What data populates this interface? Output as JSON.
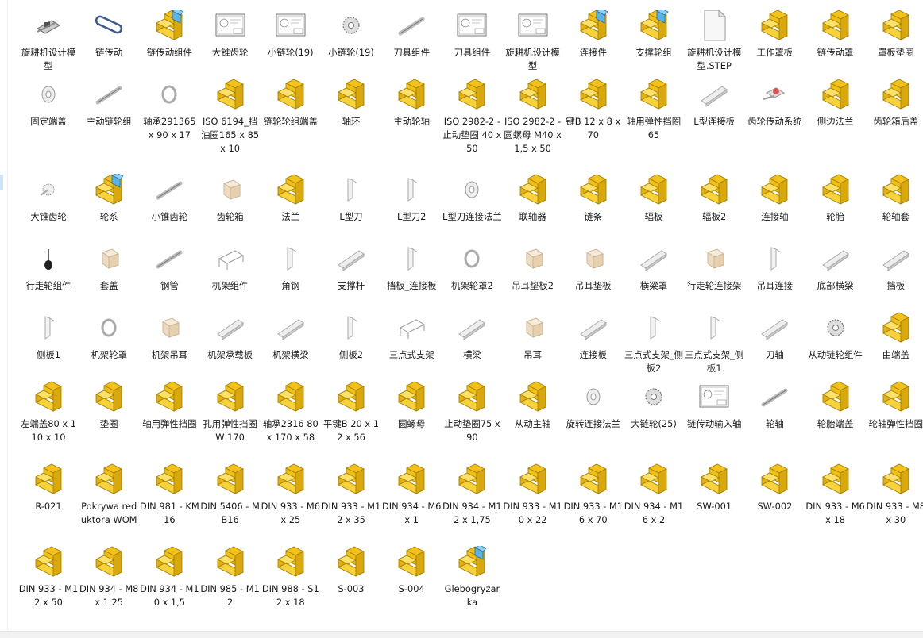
{
  "colors": {
    "part_yellow": "#f2c21b",
    "assembly_blue": "#5ab3e6",
    "line_gray": "#9a9a9a"
  },
  "rows": [
    [
      {
        "label": "旋耕机设计模型",
        "icon": "assembly-thumbnail-icon"
      },
      {
        "label": "链传动",
        "icon": "chain-thumbnail-icon"
      },
      {
        "label": "链传动组件",
        "icon": "assembly-icon"
      },
      {
        "label": "大锥齿轮",
        "icon": "drawing-thumbnail-icon"
      },
      {
        "label": "小链轮(19)",
        "icon": "drawing-thumbnail-icon"
      },
      {
        "label": "小链轮(19)",
        "icon": "sprocket-thumbnail-icon"
      },
      {
        "label": "刀具组件",
        "icon": "shaft-thumbnail-icon"
      },
      {
        "label": "刀具组件",
        "icon": "drawing-thumbnail-icon"
      },
      {
        "label": "旋耕机设计模型",
        "icon": "drawing-thumbnail-icon"
      },
      {
        "label": "连接件",
        "icon": "assembly-icon"
      },
      {
        "label": "支撑轮组",
        "icon": "assembly-icon"
      },
      {
        "label": "旋耕机设计模型.STEP",
        "icon": "file-icon"
      },
      {
        "label": "工作罩板",
        "icon": "part-icon"
      },
      {
        "label": "链传动罩",
        "icon": "part-icon"
      },
      {
        "label": "罩板垫圈",
        "icon": "part-icon"
      }
    ],
    [
      {
        "label": "固定端盖",
        "icon": "disc-thumbnail-icon"
      },
      {
        "label": "主动链轮组",
        "icon": "shaft-thumbnail-icon"
      },
      {
        "label": "轴承291365 x 90 x 17",
        "icon": "ring-thumbnail-icon"
      },
      {
        "label": "ISO 6194_挡油圈165 x 85 x 10",
        "icon": "part-icon"
      },
      {
        "label": "链轮轮组端盖",
        "icon": "part-icon"
      },
      {
        "label": "轴环",
        "icon": "part-icon"
      },
      {
        "label": "主动轮轴",
        "icon": "part-icon"
      },
      {
        "label": "ISO 2982-2 -止动垫圈 40 x 50",
        "icon": "part-icon"
      },
      {
        "label": "ISO 2982-2 -圆螺母 M40 x 1,5 x 50",
        "icon": "part-icon"
      },
      {
        "label": "键B 12 x 8 x 70",
        "icon": "part-icon"
      },
      {
        "label": "轴用弹性挡圈 65",
        "icon": "part-icon"
      },
      {
        "label": "L型连接板",
        "icon": "plate-thumbnail-icon"
      },
      {
        "label": "齿轮传动系统",
        "icon": "gearbox-thumbnail-icon"
      },
      {
        "label": "侧边法兰",
        "icon": "part-icon"
      },
      {
        "label": "齿轮箱后盖",
        "icon": "part-icon"
      }
    ],
    [
      {
        "label": "大锥齿轮",
        "icon": "gear-thumbnail-icon"
      },
      {
        "label": "轮系",
        "icon": "assembly-icon"
      },
      {
        "label": "小锥齿轮",
        "icon": "shaft-thumbnail-icon"
      },
      {
        "label": "齿轮箱",
        "icon": "box-thumbnail-icon"
      },
      {
        "label": "法兰",
        "icon": "part-icon"
      },
      {
        "label": "L型刀",
        "icon": "blade-thumbnail-icon"
      },
      {
        "label": "L型刀2",
        "icon": "blade-thumbnail-icon"
      },
      {
        "label": "L型刀连接法兰",
        "icon": "disc-thumbnail-icon"
      },
      {
        "label": "联轴器",
        "icon": "part-icon"
      },
      {
        "label": "链条",
        "icon": "part-icon"
      },
      {
        "label": "辐板",
        "icon": "part-icon"
      },
      {
        "label": "辐板2",
        "icon": "part-icon"
      },
      {
        "label": "连接轴",
        "icon": "part-icon"
      },
      {
        "label": "轮胎",
        "icon": "part-icon"
      },
      {
        "label": "轮轴套",
        "icon": "part-icon"
      }
    ],
    [
      {
        "label": "行走轮组件",
        "icon": "wheel-thumbnail-icon"
      },
      {
        "label": "套盖",
        "icon": "box-thumbnail-icon"
      },
      {
        "label": "钢管",
        "icon": "shaft-thumbnail-icon"
      },
      {
        "label": "机架组件",
        "icon": "frame-thumbnail-icon"
      },
      {
        "label": "角钢",
        "icon": "blade-thumbnail-icon"
      },
      {
        "label": "支撑杆",
        "icon": "plate-thumbnail-icon"
      },
      {
        "label": "挡板_连接板",
        "icon": "blade-thumbnail-icon"
      },
      {
        "label": "机架轮罩2",
        "icon": "ring-thumbnail-icon"
      },
      {
        "label": "吊耳垫板2",
        "icon": "box-thumbnail-icon"
      },
      {
        "label": "吊耳垫板",
        "icon": "box-thumbnail-icon"
      },
      {
        "label": "横梁罩",
        "icon": "plate-thumbnail-icon"
      },
      {
        "label": "行走轮连接架",
        "icon": "box-thumbnail-icon"
      },
      {
        "label": "吊耳连接",
        "icon": "blade-thumbnail-icon"
      },
      {
        "label": "底部横梁",
        "icon": "plate-thumbnail-icon"
      },
      {
        "label": "挡板",
        "icon": "plate-thumbnail-icon"
      }
    ],
    [
      {
        "label": "侧板1",
        "icon": "blade-thumbnail-icon"
      },
      {
        "label": "机架轮罩",
        "icon": "ring-thumbnail-icon"
      },
      {
        "label": "机架吊耳",
        "icon": "box-thumbnail-icon"
      },
      {
        "label": "机架承载板",
        "icon": "plate-thumbnail-icon"
      },
      {
        "label": "机架横梁",
        "icon": "plate-thumbnail-icon"
      },
      {
        "label": "侧板2",
        "icon": "blade-thumbnail-icon"
      },
      {
        "label": "三点式支架",
        "icon": "frame-thumbnail-icon"
      },
      {
        "label": "横梁",
        "icon": "plate-thumbnail-icon"
      },
      {
        "label": "吊耳",
        "icon": "box-thumbnail-icon"
      },
      {
        "label": "连接板",
        "icon": "plate-thumbnail-icon"
      },
      {
        "label": "三点式支架_侧板2",
        "icon": "blade-thumbnail-icon"
      },
      {
        "label": "三点式支架_侧板1",
        "icon": "blade-thumbnail-icon"
      },
      {
        "label": "刀轴",
        "icon": "plate-thumbnail-icon"
      },
      {
        "label": "从动链轮组件",
        "icon": "sprocket-thumbnail-icon"
      },
      {
        "label": "由端盖",
        "icon": "part-icon"
      }
    ],
    [
      {
        "label": "左端盖80 x 110 x 10",
        "icon": "part-icon"
      },
      {
        "label": "垫圈",
        "icon": "part-icon"
      },
      {
        "label": "轴用弹性挡圈",
        "icon": "part-icon"
      },
      {
        "label": "孔用弹性挡圈W 170",
        "icon": "part-icon"
      },
      {
        "label": "轴承2316 80 x 170 x 58",
        "icon": "part-icon"
      },
      {
        "label": "平键B 20 x 12 x 56",
        "icon": "part-icon"
      },
      {
        "label": "圆螺母",
        "icon": "part-icon"
      },
      {
        "label": "止动垫圈75 x 90",
        "icon": "part-icon"
      },
      {
        "label": "从动主轴",
        "icon": "part-icon"
      },
      {
        "label": "旋转连接法兰",
        "icon": "disc-thumbnail-icon"
      },
      {
        "label": "大链轮(25)",
        "icon": "sprocket-thumbnail-icon"
      },
      {
        "label": "链传动输入轴",
        "icon": "drawing-thumbnail-icon"
      },
      {
        "label": "轮轴",
        "icon": "shaft-thumbnail-icon"
      },
      {
        "label": "轮胎端盖",
        "icon": "part-icon"
      },
      {
        "label": "轮轴弹性挡圈",
        "icon": "part-icon"
      }
    ],
    [
      {
        "label": "R-021",
        "icon": "part-icon"
      },
      {
        "label": "Pokrywa reduktora WOM",
        "icon": "part-icon"
      },
      {
        "label": "DIN 981 - KM 16",
        "icon": "part-icon"
      },
      {
        "label": "DIN 5406 - MB16",
        "icon": "part-icon"
      },
      {
        "label": "DIN 933 - M6  x 25",
        "icon": "part-icon"
      },
      {
        "label": "DIN 933 - M12  x 35",
        "icon": "part-icon"
      },
      {
        "label": "DIN 934 - M6 x 1",
        "icon": "part-icon"
      },
      {
        "label": "DIN 934 - M12 x 1,75",
        "icon": "part-icon"
      },
      {
        "label": "DIN 933 - M10  x 22",
        "icon": "part-icon"
      },
      {
        "label": "DIN 933 - M16  x 70",
        "icon": "part-icon"
      },
      {
        "label": "DIN 934 - M16 x 2",
        "icon": "part-icon"
      },
      {
        "label": "SW-001",
        "icon": "part-icon"
      },
      {
        "label": "SW-002",
        "icon": "part-icon"
      },
      {
        "label": "DIN 933 - M6  x 18",
        "icon": "part-icon"
      },
      {
        "label": "DIN 933 - M8  x 30",
        "icon": "part-icon"
      }
    ],
    [
      {
        "label": "DIN 933 - M12  x 50",
        "icon": "part-icon"
      },
      {
        "label": "DIN 934 - M8 x 1,25",
        "icon": "part-icon"
      },
      {
        "label": "DIN 934 - M10 x 1,5",
        "icon": "part-icon"
      },
      {
        "label": "DIN 985 - M12",
        "icon": "part-icon"
      },
      {
        "label": "DIN 988 - S12 x 18",
        "icon": "part-icon"
      },
      {
        "label": "S-003",
        "icon": "part-icon"
      },
      {
        "label": "S-004",
        "icon": "part-icon"
      },
      {
        "label": "Glebogryzarka",
        "icon": "assembly-icon"
      }
    ]
  ]
}
